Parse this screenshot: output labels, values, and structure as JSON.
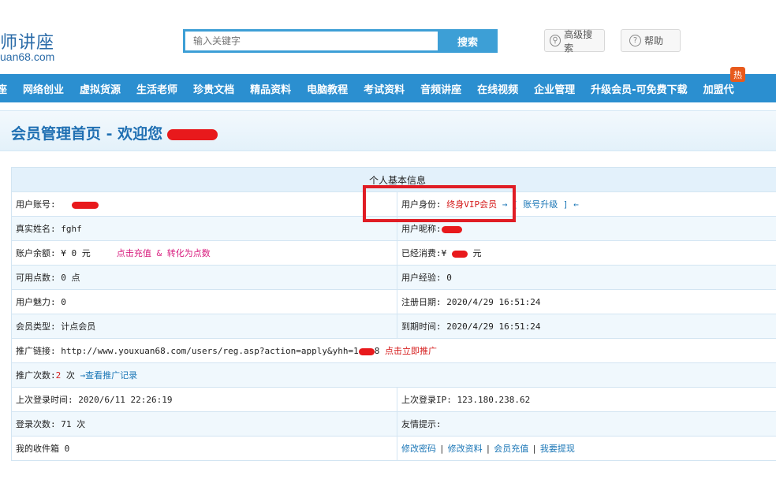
{
  "header": {
    "logo_text": "师讲座",
    "logo_domain": "uan68.com",
    "search_placeholder": "输入关键字",
    "search_button": "搜索",
    "advanced_search": "高级搜索",
    "help": "帮助"
  },
  "nav": {
    "items": [
      "座",
      "网络创业",
      "虚拟货源",
      "生活老师",
      "珍贵文档",
      "精品资料",
      "电脑教程",
      "考试资料",
      "音频讲座",
      "在线视频",
      "企业管理",
      "升级会员-可免费下载",
      "加盟代"
    ],
    "hot_badge": "热"
  },
  "page": {
    "title": "会员管理首页 - 欢迎您"
  },
  "info": {
    "section_title": "个人基本信息",
    "account_label": "用户账号:",
    "identity_label": "用户身份:",
    "identity_value": "终身VIP会员",
    "upgrade_arrow_left": "→",
    "upgrade_link": "[ 账号升级 ]",
    "upgrade_arrow_right": "←",
    "realname_label": "真实姓名:",
    "realname_value": "fghf",
    "nickname_label": "用户昵称:",
    "balance_label": "账户余额:",
    "balance_value": "¥ 0 元",
    "recharge_link": "点击充值 & 转化为点数",
    "spent_label": "已经消费:",
    "spent_prefix": "¥",
    "spent_suffix": "元",
    "points_label": "可用点数:",
    "points_value": "0 点",
    "exp_label": "用户经验:",
    "exp_value": "0",
    "charm_label": "用户魅力:",
    "charm_value": "0",
    "regdate_label": "注册日期:",
    "regdate_value": "2020/4/29 16:51:24",
    "type_label": "会员类型:",
    "type_value": "计点会员",
    "expire_label": "到期时间:",
    "expire_value": "2020/4/29 16:51:24",
    "promo_label": "推广链接:",
    "promo_url": "http://www.youxuan68.com/users/reg.asp?action=apply&yhh=1",
    "promo_url_end": "8",
    "promo_link": "点击立即推广",
    "promo_count_label": "推广次数:",
    "promo_count_value": "2",
    "promo_count_unit": "次",
    "promo_record_link": "→查看推广记录",
    "last_login_label": "上次登录时间:",
    "last_login_value": "2020/6/11 22:26:19",
    "last_ip_label": "上次登录IP:",
    "last_ip_value": "123.180.238.62",
    "login_count_label": "登录次数:",
    "login_count_value": "71 次",
    "tip_label": "友情提示:",
    "inbox_label": "我的收件箱",
    "inbox_value": "0",
    "actions": [
      "修改密码",
      "修改资料",
      "会员充值",
      "我要提现"
    ]
  },
  "colors": {
    "nav_bg": "#2b8fd0",
    "title_blue": "#1f6fb2",
    "highlight_red": "#e01d25"
  }
}
